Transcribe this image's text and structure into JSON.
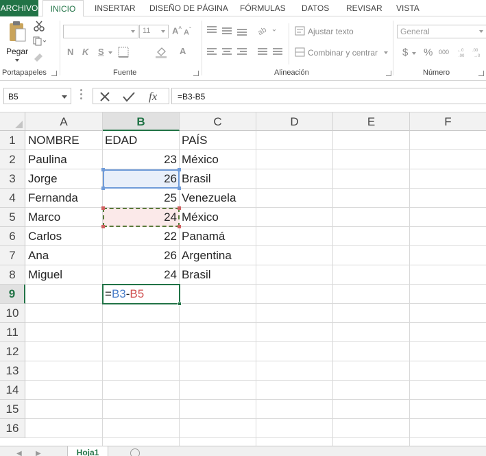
{
  "ribbon_tabs": {
    "file": "ARCHIVO",
    "home": "INICIO",
    "insert": "INSERTAR",
    "page_layout": "DISEÑO DE PÁGINA",
    "formulas": "FÓRMULAS",
    "data": "DATOS",
    "review": "REVISAR",
    "view": "VISTA"
  },
  "ribbon": {
    "clipboard": {
      "paste_label": "Pegar",
      "group_label": "Portapapeles"
    },
    "font": {
      "font_name": "",
      "font_size": "11",
      "bold": "N",
      "italic": "K",
      "underline": "S",
      "group_label": "Fuente"
    },
    "alignment": {
      "wrap_text": "Ajustar texto",
      "merge_center": "Combinar y centrar",
      "group_label": "Alineación"
    },
    "number": {
      "format": "General",
      "currency": "$",
      "percent": "%",
      "thousands": "000",
      "group_label": "Número"
    }
  },
  "formula_bar": {
    "name_box": "B5",
    "formula": "=B3-B5"
  },
  "columns": [
    "A",
    "B",
    "C",
    "D",
    "E",
    "F"
  ],
  "rows": [
    "1",
    "2",
    "3",
    "4",
    "5",
    "6",
    "7",
    "8",
    "9",
    "10",
    "11",
    "12",
    "13",
    "14",
    "15",
    "16"
  ],
  "cells": {
    "r1": {
      "a": "NOMBRE",
      "b": "EDAD",
      "c": "PAÍS"
    },
    "r2": {
      "a": "Paulina",
      "b": "23",
      "c": "México"
    },
    "r3": {
      "a": "Jorge",
      "b": "26",
      "c": "Brasil"
    },
    "r4": {
      "a": "Fernanda",
      "b": "25",
      "c": "Venezuela"
    },
    "r5": {
      "a": "Marco",
      "b": "24",
      "c": "México"
    },
    "r6": {
      "a": "Carlos",
      "b": "22",
      "c": "Panamá"
    },
    "r7": {
      "a": "Ana",
      "b": "26",
      "c": "Argentina"
    },
    "r8": {
      "a": "Miguel",
      "b": "24",
      "c": "Brasil"
    }
  },
  "editing_cell": {
    "eq": "=",
    "ref1": "B3",
    "minus": "-",
    "ref2": "B5"
  },
  "sheet_tabs": {
    "active": "Hoja1"
  },
  "colors": {
    "excel_green": "#217346",
    "ref_blue": "#6f9bd9",
    "ref_red": "#d06060"
  }
}
